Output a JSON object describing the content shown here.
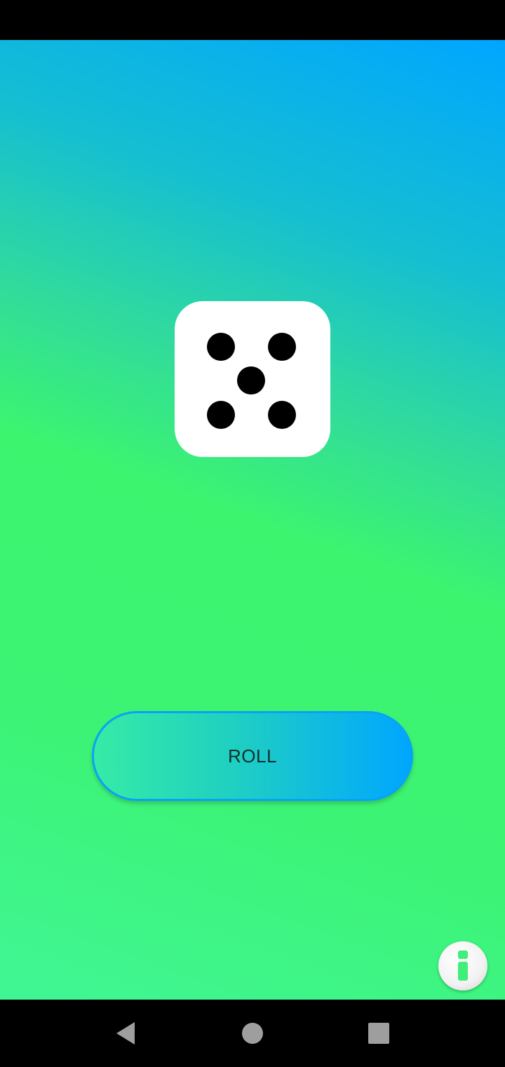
{
  "dice": {
    "value": 5
  },
  "roll_button": {
    "label": "ROLL"
  },
  "info_button": {
    "icon": "info-icon"
  },
  "nav": {
    "back_icon": "back-triangle-icon",
    "home_icon": "home-circle-icon",
    "recents_icon": "recents-square-icon"
  },
  "colors": {
    "gradient_top": "#00a6ff",
    "gradient_mid": "#3df46f",
    "gradient_bottom": "#40f695",
    "button_border": "#08a3f6",
    "info_glyph": "#3ef07a"
  }
}
